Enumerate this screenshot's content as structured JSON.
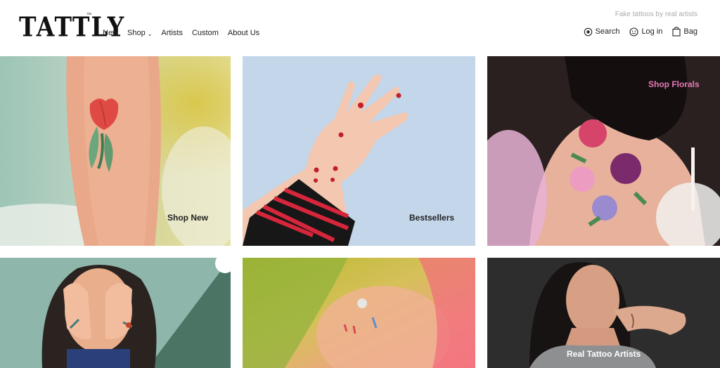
{
  "brand": {
    "logo_text": "TATTLY",
    "trademark": "™",
    "tagline": "Fake tattoos by real artists"
  },
  "nav": [
    {
      "label": "New"
    },
    {
      "label": "Shop",
      "chevron": "chevron-down-icon"
    },
    {
      "label": "Artists"
    },
    {
      "label": "Custom"
    },
    {
      "label": "About Us"
    }
  ],
  "utility": {
    "search": {
      "label": "Search",
      "icon": "search-icon"
    },
    "login": {
      "label": "Log in",
      "icon": "smiley-icon"
    },
    "bag": {
      "label": "Bag",
      "icon": "bag-icon"
    }
  },
  "tiles": [
    {
      "label": "Shop New"
    },
    {
      "label": "Bestsellers"
    },
    {
      "label": "Shop Florals"
    },
    {
      "label": ""
    },
    {
      "label": ""
    },
    {
      "label": "Real Tattoo Artists"
    }
  ],
  "colors": {
    "accent_pink": "#e479b8",
    "tagline_gray": "#aaaaaa"
  }
}
